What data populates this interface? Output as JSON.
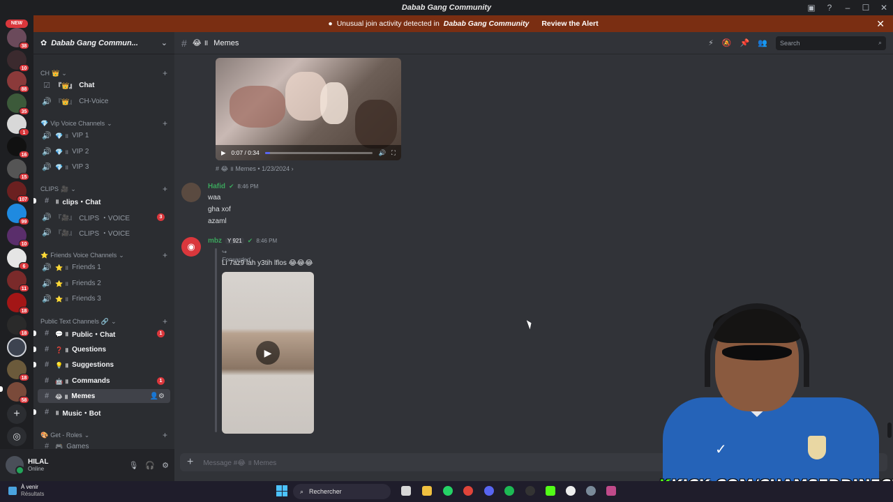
{
  "window": {
    "title": "Dabab Gang Community"
  },
  "alert": {
    "text": "Unusual join activity detected in",
    "community": "Dabab Gang Community",
    "action": "Review the Alert"
  },
  "servers": {
    "new_label": "NEW",
    "badges": [
      "38",
      "10",
      "88",
      "35",
      "1",
      "16",
      "15",
      "107",
      "99",
      "10",
      "6",
      "11",
      "18",
      "18",
      "58"
    ]
  },
  "guild": {
    "name": "Dabab Gang Commun..."
  },
  "categories": {
    "ch": "CH",
    "vip": "Vip Voice Channels",
    "clips": "CLIPS",
    "friends": "Friends Voice Channels",
    "public": "Public Text Channels",
    "roles": "Get - Roles"
  },
  "channels": {
    "chat": "Chat",
    "ch_voice": "CH-Voice",
    "vip1": "VIP 1",
    "vip2": "VIP 2",
    "vip3": "VIP 3",
    "clips_chat": "clips・Chat",
    "clips_voice_1": "CLIPS ・VOICE",
    "clips_voice_2": "CLIPS ・VOICE",
    "clips_voice_1_unread": "3",
    "friends1": "Friends 1",
    "friends2": "Friends 2",
    "friends3": "Friends 3",
    "public_chat": "Public・Chat",
    "public_chat_unread": "1",
    "questions": "Questions",
    "suggestions": "Suggestions",
    "commands": "Commands",
    "commands_unread": "1",
    "memes": "Memes",
    "music_bot": "Music・Bot",
    "games": "Games"
  },
  "user": {
    "name": "HILAL",
    "status": "Online"
  },
  "header": {
    "channel": "Memes",
    "search_placeholder": "Search"
  },
  "messages": {
    "video1": {
      "time": "0:07 / 0:34",
      "progress": 0.05
    },
    "fwd_meta": "Memes • 1/23/2024",
    "m1": {
      "author": "Hafid",
      "time": "8:46 PM",
      "lines": [
        "waa",
        "gha xof",
        "azaml"
      ],
      "color": "#3ba55c"
    },
    "m2": {
      "author": "mbz",
      "tag": "921",
      "time": "8:46 PM",
      "forwarded": "Forwarded",
      "text": "Li 7az9 lah y3tih lflos",
      "emoji": "😂😂😂",
      "color": "#3ba55c"
    }
  },
  "composer": {
    "placeholder": "Message #",
    "channel": "Memes"
  },
  "overlay": {
    "kick_text": "KICK.COM/CHAMSEDDINECH"
  },
  "taskbar": {
    "weather_title": "À venir",
    "weather_sub": "Résultats",
    "search": "Rechercher"
  }
}
